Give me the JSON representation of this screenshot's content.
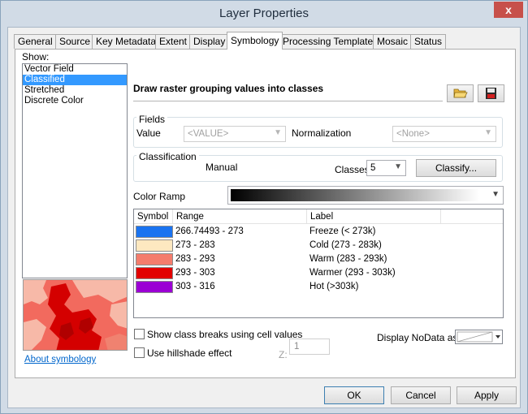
{
  "window": {
    "title": "Layer Properties",
    "close_glyph": "x"
  },
  "tabs": [
    {
      "label": "General"
    },
    {
      "label": "Source"
    },
    {
      "label": "Key Metadata"
    },
    {
      "label": "Extent"
    },
    {
      "label": "Display"
    },
    {
      "label": "Symbology",
      "active": true
    },
    {
      "label": "Processing Templates"
    },
    {
      "label": "Mosaic"
    },
    {
      "label": "Status"
    }
  ],
  "show": {
    "label": "Show:",
    "items": [
      "Vector Field",
      "Classified",
      "Stretched",
      "Discrete Color"
    ],
    "selected": "Classified"
  },
  "about_link": "About symbology",
  "heading": "Draw raster grouping values into classes",
  "icons": {
    "open": "folder-open-icon",
    "save": "floppy-disk-icon"
  },
  "fields": {
    "title": "Fields",
    "value_label": "Value",
    "value_selected": "<VALUE>",
    "normalization_label": "Normalization",
    "normalization_selected": "<None>"
  },
  "classification": {
    "title": "Classification",
    "method": "Manual",
    "classes_label": "Classes",
    "classes_value": "5",
    "classify_button": "Classify..."
  },
  "color_ramp": {
    "label": "Color Ramp",
    "start_color": "#000000",
    "end_color": "#ffffff"
  },
  "symbol_table": {
    "headers": [
      "Symbol",
      "Range",
      "Label"
    ],
    "rows": [
      {
        "color": "#1a73f0",
        "range": "266.74493 - 273",
        "label": "Freeze (< 273k)"
      },
      {
        "color": "#fde8c0",
        "range": "273 - 283",
        "label": "Cold (273 - 283k)"
      },
      {
        "color": "#f47c6c",
        "range": "283 - 293",
        "label": "Warm (283 - 293k)"
      },
      {
        "color": "#e20000",
        "range": "293 - 303",
        "label": "Warmer (293 - 303k)"
      },
      {
        "color": "#9b00d4",
        "range": "303 - 316",
        "label": "Hot (>303k)"
      }
    ]
  },
  "options": {
    "show_class_breaks": "Show class breaks using cell values",
    "use_hillshade": "Use hillshade effect",
    "z_label": "Z:",
    "z_value": "1",
    "nodata_label": "Display NoData as"
  },
  "buttons": {
    "ok": "OK",
    "cancel": "Cancel",
    "apply": "Apply"
  }
}
